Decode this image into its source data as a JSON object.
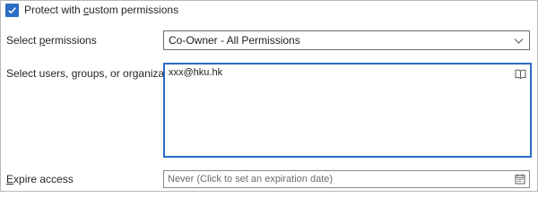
{
  "protect": {
    "label_prefix": "Protect with ",
    "label_accel": "c",
    "label_suffix": "ustom permissions",
    "checked": true
  },
  "permissions": {
    "label_prefix": "Select ",
    "label_accel": "p",
    "label_suffix": "ermissions",
    "selected": "Co-Owner - All Permissions"
  },
  "users": {
    "label": "Select users, groups, or organizations",
    "value": "xxx@hku.hk"
  },
  "expire": {
    "label_accel": "E",
    "label_suffix": "xpire access",
    "placeholder": "Never (Click to set an expiration date)"
  },
  "colors": {
    "accent": "#2b6cc4",
    "border": "#b9b9b9",
    "text": "#262626"
  },
  "icons": {
    "checkbox": "checkmark-icon",
    "select": "chevron-down-icon",
    "addressbook": "address-book-icon",
    "calendar": "calendar-icon"
  }
}
